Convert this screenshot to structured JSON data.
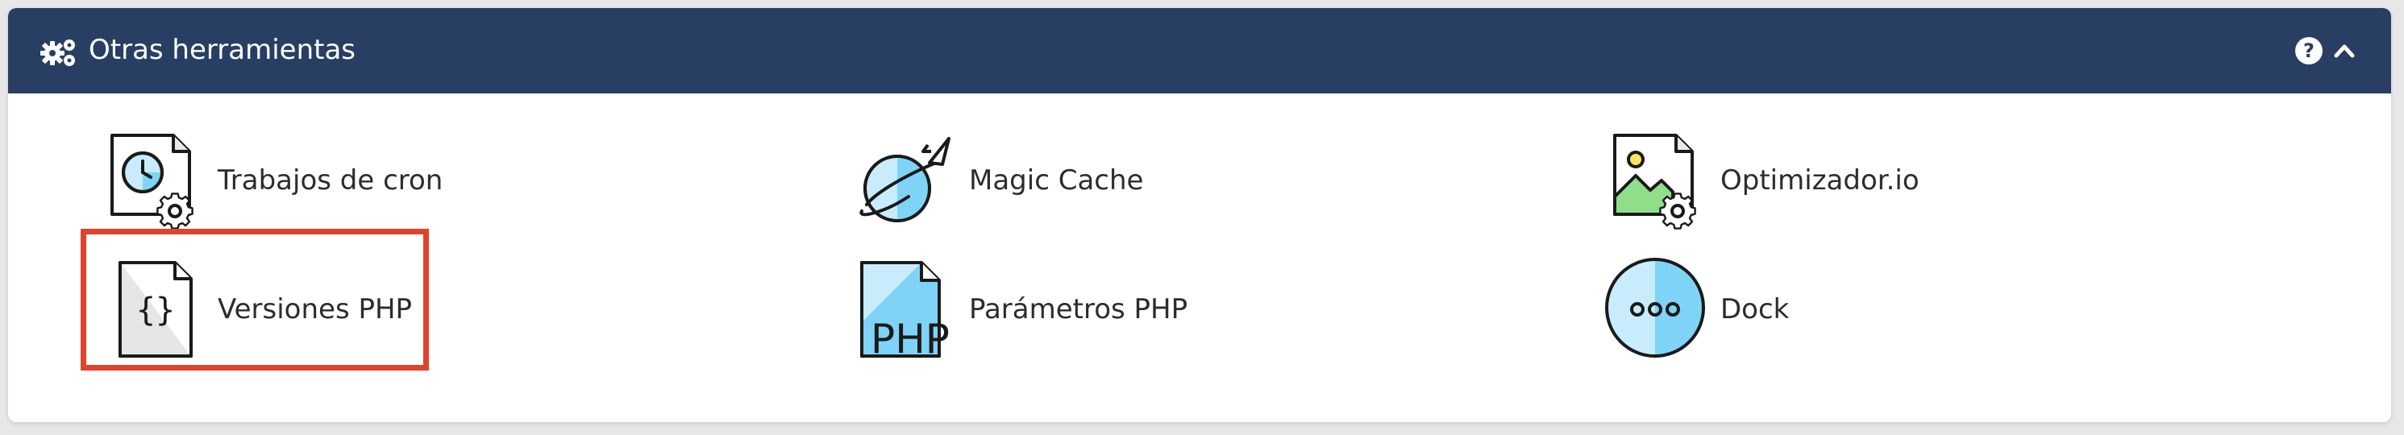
{
  "header": {
    "title": "Otras herramientas",
    "icon": "gears-icon",
    "actions": [
      {
        "name": "help-icon",
        "glyph": "?"
      },
      {
        "name": "chevron-up-icon",
        "glyph": "^"
      }
    ],
    "background": "#283f63"
  },
  "tools": [
    {
      "label": "Trabajos de cron",
      "icon": "cron-jobs-icon"
    },
    {
      "label": "Magic Cache",
      "icon": "planet-rocket-icon"
    },
    {
      "label": "Optimizador.io",
      "icon": "image-optimizer-icon"
    },
    {
      "label": "Versiones PHP",
      "icon": "php-versions-icon",
      "highlighted": true
    },
    {
      "label": "Parámetros PHP",
      "icon": "php-file-icon",
      "icon_text": "PHP"
    },
    {
      "label": "Dock",
      "icon": "dock-icon"
    }
  ],
  "colors": {
    "highlight_border": "#e0432a",
    "icon_light_blue": "#7fd3f7",
    "icon_pale_blue": "#c8ecfb",
    "icon_green": "#90dd8a",
    "icon_yellow": "#f5e660"
  }
}
